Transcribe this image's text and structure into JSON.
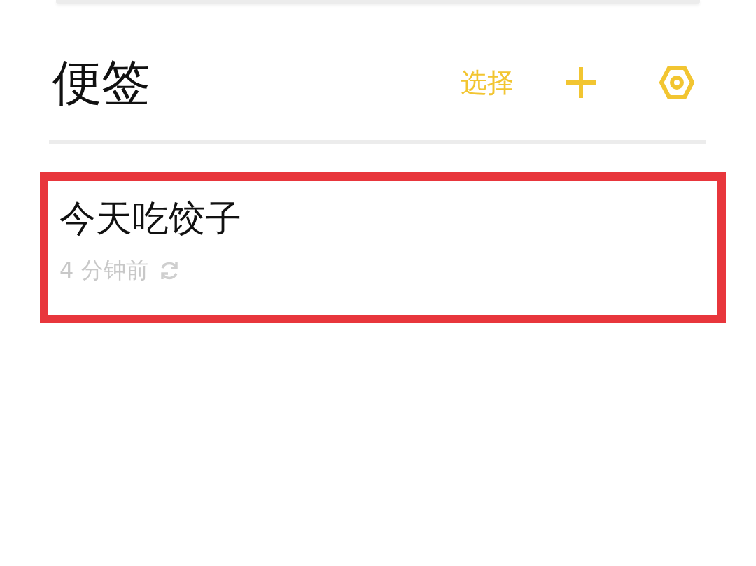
{
  "header": {
    "title": "便签",
    "select_label": "选择"
  },
  "notes": [
    {
      "title": "今天吃饺子",
      "time": "4 分钟前",
      "highlighted": true,
      "synced": true
    }
  ]
}
